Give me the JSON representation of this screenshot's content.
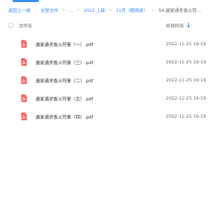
{
  "breadcrumb": {
    "back": "返回上一级",
    "all_files": "全部文件",
    "ellipsis": "...",
    "year": "2022 上新",
    "month": "11月（晒商家）",
    "current": "54.遁家通灵香火符..."
  },
  "header": {
    "name_label": "文件名",
    "time_label": "修改时间",
    "sort_icon": "sort-down-icon"
  },
  "files": [
    {
      "name": "遁家通灵香火符篆（一）.pdf",
      "modified": "2022-11-25 16:19",
      "icon": "pdf-icon"
    },
    {
      "name": "遁家通灵香火符篆（三）.pdf",
      "modified": "2022-11-25 16:19",
      "icon": "pdf-icon"
    },
    {
      "name": "遁家通灵香火符篆（二）.pdf",
      "modified": "2022-11-25 16:19",
      "icon": "pdf-icon"
    },
    {
      "name": "遁家通灵香火符篆（五）.pdf",
      "modified": "2022-11-25 16:19",
      "icon": "pdf-icon"
    },
    {
      "name": "遁家通灵香火符篆（四）.pdf",
      "modified": "2022-11-25 16:19",
      "icon": "pdf-icon"
    }
  ],
  "colors": {
    "accent": "#3a8cff",
    "pdf": "#f0625d"
  }
}
